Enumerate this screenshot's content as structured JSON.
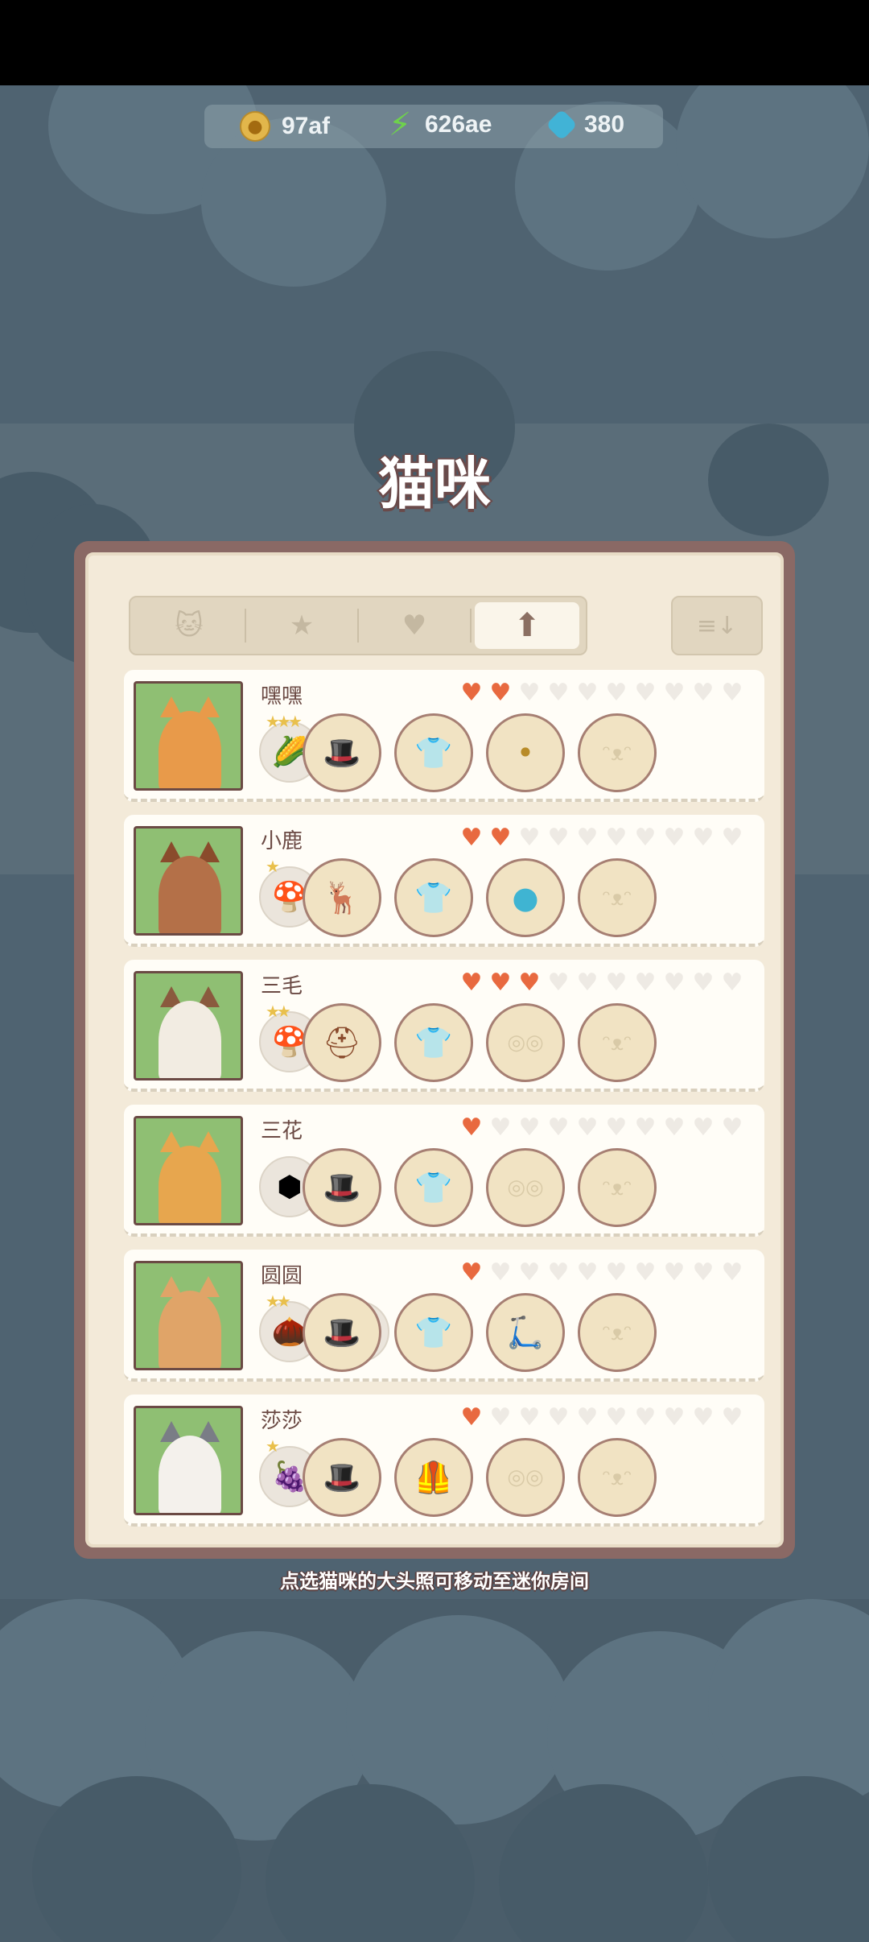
{
  "resources": {
    "coins": "97af",
    "energy": "626ae",
    "gems": "380"
  },
  "title": "猫咪",
  "tabs": [
    {
      "icon": "cat-icon",
      "glyph": "🐱"
    },
    {
      "icon": "star-icon",
      "glyph": "★"
    },
    {
      "icon": "heart-icon",
      "glyph": "♥"
    },
    {
      "icon": "up-arrow-icon",
      "glyph": "⬆"
    }
  ],
  "sort_glyph": "≡↓",
  "cats": [
    {
      "name": "嘿嘿",
      "hearts": 2,
      "badge": "corn",
      "badge_glyph": "🌽",
      "badge_stars": "★★★",
      "extra": "",
      "slots": [
        "hat",
        "shirt",
        "glasses-item",
        "face"
      ]
    },
    {
      "name": "小鹿",
      "hearts": 2,
      "badge": "mushroom",
      "badge_glyph": "🍄",
      "badge_stars": "★",
      "extra": "",
      "slots": [
        "antlers",
        "shirt",
        "blue-orb",
        "face"
      ]
    },
    {
      "name": "三毛",
      "hearts": 3,
      "badge": "mushroom",
      "badge_glyph": "🍄",
      "badge_stars": "★★",
      "extra": "",
      "slots": [
        "aviator-helmet",
        "shirt",
        "glasses",
        "face"
      ]
    },
    {
      "name": "三花",
      "hearts": 1,
      "badge": "honeycomb",
      "badge_glyph": "⬢",
      "badge_stars": "",
      "extra": "",
      "slots": [
        "hat",
        "shirt",
        "glasses",
        "face"
      ]
    },
    {
      "name": "圆圆",
      "hearts": 1,
      "badge": "acorns",
      "badge_glyph": "🌰",
      "badge_stars": "★★",
      "extra": "?",
      "slots": [
        "hat",
        "shirt",
        "scooter",
        "face"
      ]
    },
    {
      "name": "莎莎",
      "hearts": 1,
      "badge": "grapes",
      "badge_glyph": "🍇",
      "badge_stars": "★",
      "extra": "",
      "slots": [
        "hat",
        "red-vest",
        "glasses",
        "face"
      ]
    }
  ],
  "hint": "点选猫咪的大头照可移动至迷你房间",
  "colors": {
    "heart_on": "#e8693f",
    "heart_off": "#eeeae4",
    "panel_frame": "#8a6965",
    "portrait_bg": "#8fbf73"
  }
}
